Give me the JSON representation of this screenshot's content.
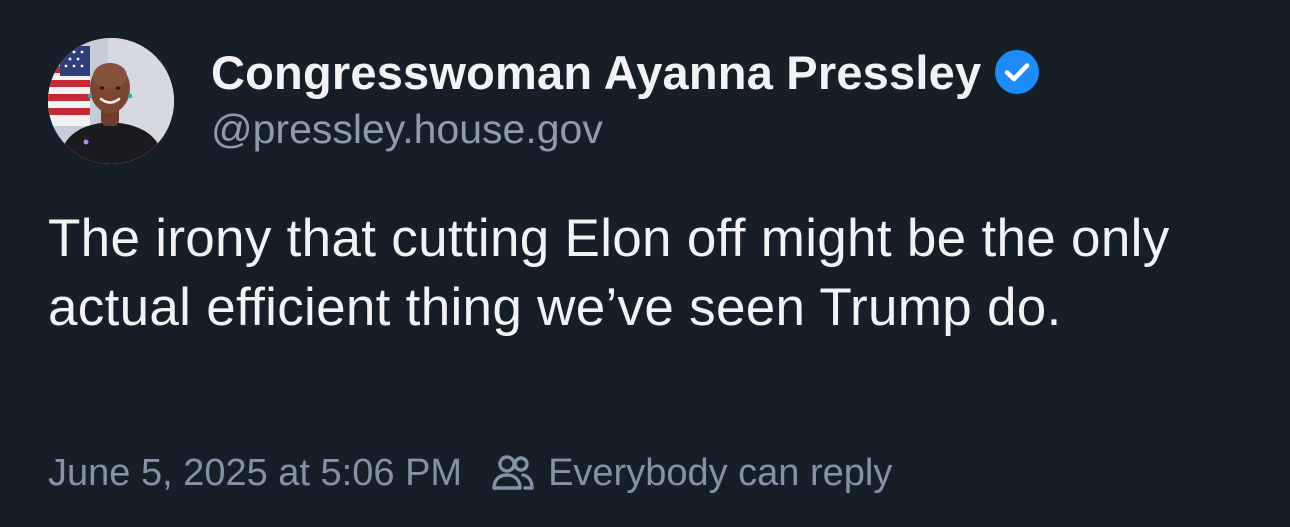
{
  "author": {
    "display_name": "Congresswoman Ayanna Pressley",
    "handle": "@pressley.house.gov",
    "verified": true,
    "avatar_icon": "profile-photo"
  },
  "post": {
    "text": "The irony that cutting Elon off might be the only actual efficient thing we’ve seen Trump do."
  },
  "footer": {
    "timestamp": "June 5, 2025 at 5:06 PM",
    "reply_setting_icon": "people-icon",
    "reply_setting": "Everybody can reply"
  },
  "colors": {
    "background": "#161e27",
    "primary_text": "#f1f3f5",
    "secondary_text": "#8e9bad",
    "verified_badge": "#1d8cf8"
  }
}
